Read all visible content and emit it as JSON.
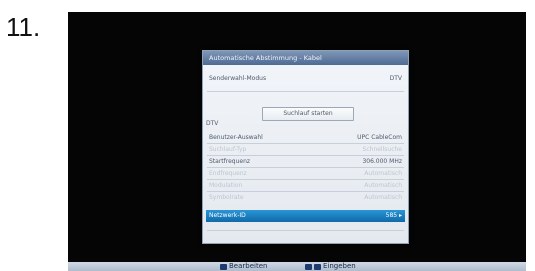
{
  "step_number": "11.",
  "menu": {
    "title": "Automatische Abstimmung - Kabel",
    "mode": {
      "label": "Senderwahl-Modus",
      "value": "DTV"
    },
    "scan_button": "Suchlauf starten",
    "section": "DTV",
    "rows": [
      {
        "label": "Benutzer-Auswahl",
        "value": "UPC CableCom",
        "enabled": true
      },
      {
        "label": "Suchlauf-Typ",
        "value": "Schnellsuche",
        "enabled": false
      },
      {
        "label": "Startfrequenz",
        "value": "306.000 MHz",
        "enabled": true
      },
      {
        "label": "Endfrequenz",
        "value": "Automatisch",
        "enabled": false
      },
      {
        "label": "Modulation",
        "value": "Automatisch",
        "enabled": false
      },
      {
        "label": "Symbolrate",
        "value": "Automatisch",
        "enabled": false
      }
    ],
    "selected": {
      "label": "Netzwerk-ID",
      "value": "585 ▸"
    }
  },
  "bottom_bar": {
    "edit_label": "Bearbeiten",
    "input_label": "Eingeben"
  }
}
